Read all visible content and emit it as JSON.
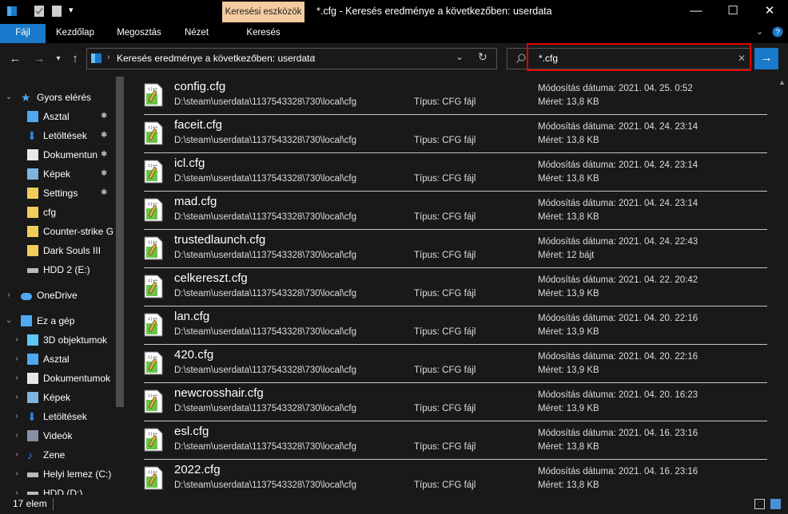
{
  "title_bar": {
    "context_tab": "Keresési eszközök",
    "window_title": "*.cfg - Keresés eredménye a következőben: userdata",
    "minimize": "—",
    "maximize": "☐",
    "close": "✕"
  },
  "ribbon": {
    "tabs": [
      "Fájl",
      "Kezdőlap",
      "Megosztás",
      "Nézet",
      "Keresés"
    ],
    "collapse_icon": "chevron-down-icon",
    "help_icon": "help-icon"
  },
  "navigation": {
    "address": "Keresés eredménye a következőben: userdata",
    "address_separator": "›",
    "search_value": "*.cfg",
    "search_clear": "✕"
  },
  "sidebar": {
    "items": [
      {
        "label": "Gyors elérés",
        "icon": "star-icon",
        "level": 0,
        "pinned": false
      },
      {
        "label": "Asztal",
        "icon": "desktop-icon",
        "level": 1,
        "pinned": true
      },
      {
        "label": "Letöltések",
        "icon": "download-icon",
        "level": 1,
        "pinned": true
      },
      {
        "label": "Dokumentun",
        "icon": "document-icon",
        "level": 1,
        "pinned": true
      },
      {
        "label": "Képek",
        "icon": "pictures-icon",
        "level": 1,
        "pinned": true
      },
      {
        "label": "Settings",
        "icon": "folder-icon",
        "level": 1,
        "pinned": true
      },
      {
        "label": "cfg",
        "icon": "folder-icon",
        "level": 1,
        "pinned": false
      },
      {
        "label": "Counter-strike  G",
        "icon": "folder-icon",
        "level": 1,
        "pinned": false
      },
      {
        "label": "Dark Souls III",
        "icon": "folder-icon",
        "level": 1,
        "pinned": false
      },
      {
        "label": "HDD 2 (E:)",
        "icon": "drive-icon",
        "level": 1,
        "pinned": false
      },
      {
        "label": "OneDrive",
        "icon": "cloud-icon",
        "level": 0,
        "pinned": false
      },
      {
        "label": "Ez a gép",
        "icon": "computer-icon",
        "level": 0,
        "pinned": false
      },
      {
        "label": "3D objektumok",
        "icon": "cube-icon",
        "level": 1,
        "pinned": false
      },
      {
        "label": "Asztal",
        "icon": "desktop-icon",
        "level": 1,
        "pinned": false
      },
      {
        "label": "Dokumentumok",
        "icon": "document-icon",
        "level": 1,
        "pinned": false
      },
      {
        "label": "Képek",
        "icon": "pictures-icon",
        "level": 1,
        "pinned": false
      },
      {
        "label": "Letöltések",
        "icon": "download-icon",
        "level": 1,
        "pinned": false
      },
      {
        "label": "Videók",
        "icon": "video-icon",
        "level": 1,
        "pinned": false
      },
      {
        "label": "Zene",
        "icon": "music-icon",
        "level": 1,
        "pinned": false
      },
      {
        "label": "Helyi lemez (C:)",
        "icon": "drive-icon",
        "level": 1,
        "pinned": false
      },
      {
        "label": "HDD (D:)",
        "icon": "drive-icon",
        "level": 1,
        "pinned": false
      }
    ],
    "pin_glyph": "📌"
  },
  "files": [
    {
      "name": "config.cfg",
      "path": "D:\\steam\\userdata\\1137543328\\730\\local\\cfg",
      "type": "Típus: CFG fájl",
      "date": "Módosítás dátuma: 2021. 04. 25. 0:52",
      "size": "Méret: 13,8 KB"
    },
    {
      "name": "faceit.cfg",
      "path": "D:\\steam\\userdata\\1137543328\\730\\local\\cfg",
      "type": "Típus: CFG fájl",
      "date": "Módosítás dátuma: 2021. 04. 24. 23:14",
      "size": "Méret: 13,8 KB"
    },
    {
      "name": "icl.cfg",
      "path": "D:\\steam\\userdata\\1137543328\\730\\local\\cfg",
      "type": "Típus: CFG fájl",
      "date": "Módosítás dátuma: 2021. 04. 24. 23:14",
      "size": "Méret: 13,8 KB"
    },
    {
      "name": "mad.cfg",
      "path": "D:\\steam\\userdata\\1137543328\\730\\local\\cfg",
      "type": "Típus: CFG fájl",
      "date": "Módosítás dátuma: 2021. 04. 24. 23:14",
      "size": "Méret: 13,8 KB"
    },
    {
      "name": "trustedlaunch.cfg",
      "path": "D:\\steam\\userdata\\1137543328\\730\\local\\cfg",
      "type": "Típus: CFG fájl",
      "date": "Módosítás dátuma: 2021. 04. 24. 22:43",
      "size": "Méret: 12 bájt"
    },
    {
      "name": "celkereszt.cfg",
      "path": "D:\\steam\\userdata\\1137543328\\730\\local\\cfg",
      "type": "Típus: CFG fájl",
      "date": "Módosítás dátuma: 2021. 04. 22. 20:42",
      "size": "Méret: 13,9 KB"
    },
    {
      "name": "lan.cfg",
      "path": "D:\\steam\\userdata\\1137543328\\730\\local\\cfg",
      "type": "Típus: CFG fájl",
      "date": "Módosítás dátuma: 2021. 04. 20. 22:16",
      "size": "Méret: 13,9 KB"
    },
    {
      "name": "420.cfg",
      "path": "D:\\steam\\userdata\\1137543328\\730\\local\\cfg",
      "type": "Típus: CFG fájl",
      "date": "Módosítás dátuma: 2021. 04. 20. 22:16",
      "size": "Méret: 13,9 KB"
    },
    {
      "name": "newcrosshair.cfg",
      "path": "D:\\steam\\userdata\\1137543328\\730\\local\\cfg",
      "type": "Típus: CFG fájl",
      "date": "Módosítás dátuma: 2021. 04. 20. 16:23",
      "size": "Méret: 13,9 KB"
    },
    {
      "name": "esl.cfg",
      "path": "D:\\steam\\userdata\\1137543328\\730\\local\\cfg",
      "type": "Típus: CFG fájl",
      "date": "Módosítás dátuma: 2021. 04. 16. 23:16",
      "size": "Méret: 13,8 KB"
    },
    {
      "name": "2022.cfg",
      "path": "D:\\steam\\userdata\\1137543328\\730\\local\\cfg",
      "type": "Típus: CFG fájl",
      "date": "Módosítás dátuma: 2021. 04. 16. 23:16",
      "size": "Méret: 13,8 KB"
    }
  ],
  "status_bar": {
    "count": "17 elem"
  },
  "colors": {
    "accent": "#1979ca",
    "context_tab": "#f5cca1",
    "highlight_box": "#e00000",
    "background": "#191919"
  }
}
